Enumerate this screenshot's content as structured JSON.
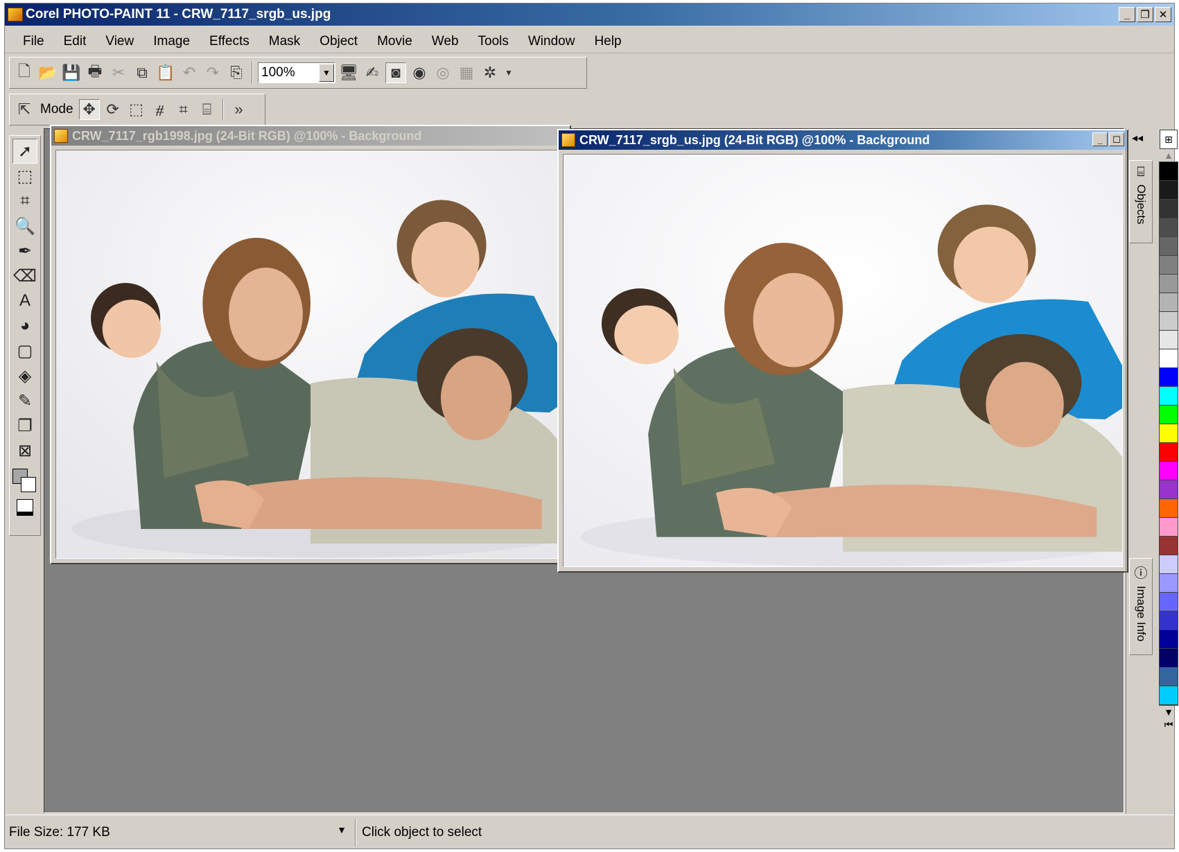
{
  "window": {
    "title": "Corel PHOTO-PAINT 11 - CRW_7117_srgb_us.jpg"
  },
  "menu": [
    "File",
    "Edit",
    "View",
    "Image",
    "Effects",
    "Mask",
    "Object",
    "Movie",
    "Web",
    "Tools",
    "Window",
    "Help"
  ],
  "toolbar": {
    "zoom_value": "100%",
    "mode_label": "Mode"
  },
  "documents": [
    {
      "title": "CRW_7117_rgb1998.jpg (24-Bit RGB) @100% - Background",
      "active": false
    },
    {
      "title": "CRW_7117_srgb_us.jpg (24-Bit RGB) @100% - Background",
      "active": true
    }
  ],
  "dockers": {
    "objects_label": "Objects",
    "image_info_label": "Image Info"
  },
  "palette_colors": [
    "#000000",
    "#1a1a1a",
    "#333333",
    "#4d4d4d",
    "#666666",
    "#808080",
    "#999999",
    "#b3b3b3",
    "#cccccc",
    "#e6e6e6",
    "#ffffff",
    "#0000ff",
    "#00ffff",
    "#00ff00",
    "#ffff00",
    "#ff0000",
    "#ff00ff",
    "#9933cc",
    "#ff6600",
    "#ff99cc",
    "#993333",
    "#ccccff",
    "#9999ff",
    "#6666ff",
    "#3333cc",
    "#000099",
    "#000066",
    "#336699",
    "#00ccff"
  ],
  "status": {
    "file_size": "File Size: 177 KB",
    "message": "Click object to select"
  }
}
